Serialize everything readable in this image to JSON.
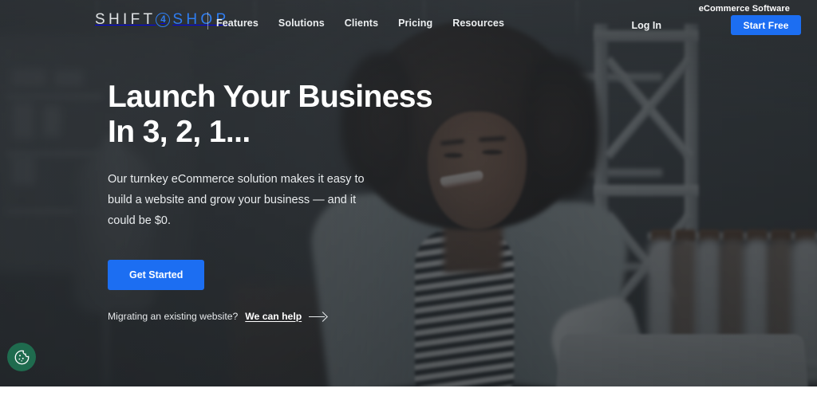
{
  "brand": {
    "logo_primary": "SHIFT",
    "logo_badge": "4",
    "logo_secondary": "SHOP",
    "accent_color": "#1c6ef2",
    "logo_accent_color": "#2f7df0"
  },
  "nav": {
    "links": [
      {
        "label": "Features"
      },
      {
        "label": "Solutions"
      },
      {
        "label": "Clients"
      },
      {
        "label": "Pricing"
      },
      {
        "label": "Resources"
      }
    ],
    "tagline": "eCommerce Software",
    "login_label": "Log In",
    "start_free_label": "Start Free"
  },
  "hero": {
    "title_line1": "Launch Your Business",
    "title_line2": "In 3, 2, 1...",
    "subtitle": "Our turnkey eCommerce solution makes it easy to build a website and grow your business — and it could be $0.",
    "cta_label": "Get Started",
    "migrate_prefix": "Migrating an existing website?",
    "migrate_link": "We can help"
  },
  "widgets": {
    "cookie_consent_label": "cookie-consent",
    "cookie_color": "#1f6b4e"
  }
}
